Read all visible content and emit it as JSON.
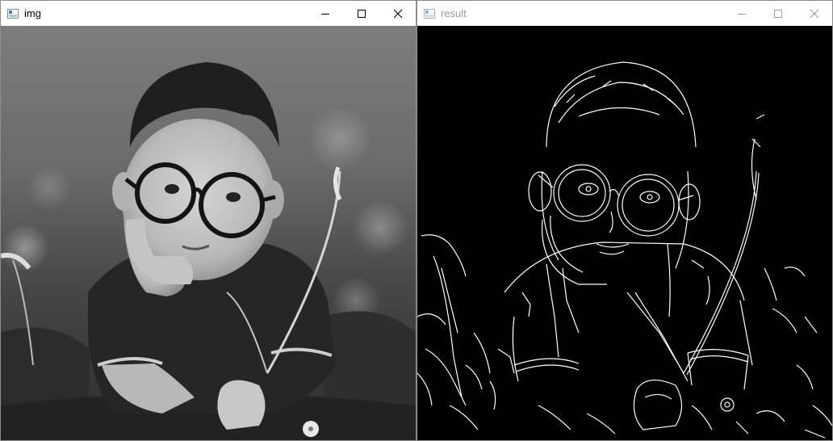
{
  "windows": {
    "img": {
      "title": "img",
      "active": true
    },
    "result": {
      "title": "result",
      "active": false
    }
  },
  "controls": {
    "minimize_icon": "minimize-icon",
    "maximize_icon": "maximize-icon",
    "close_icon": "close-icon"
  },
  "colors": {
    "titlebar_bg": "#ffffff",
    "active_title": "#000000",
    "inactive_title": "#9a9a9a",
    "edge_background": "#000000",
    "edge_lines": "#ffffff"
  },
  "images": {
    "original": "grayscale-photo-boy-glasses-in-grass",
    "edges": "canny-edge-detection-output"
  }
}
